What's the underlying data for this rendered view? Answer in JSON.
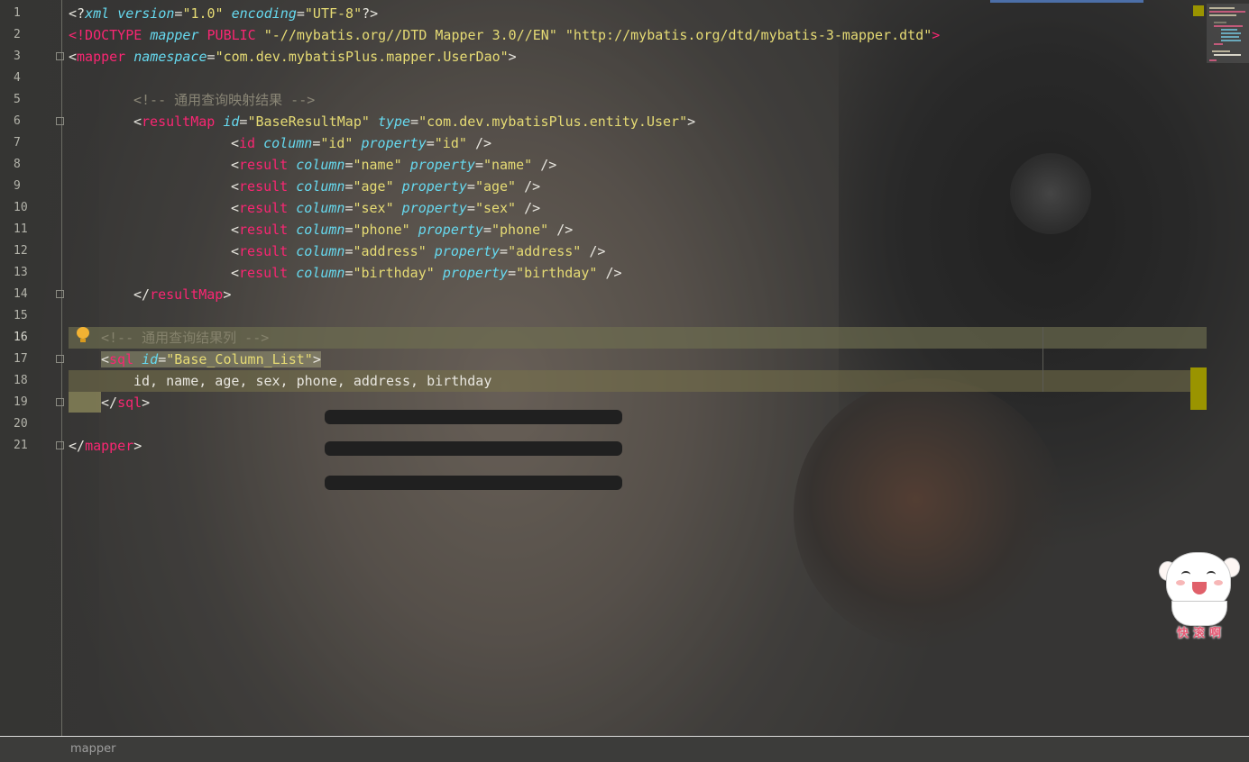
{
  "editor": {
    "line_numbers": [
      "1",
      "2",
      "3",
      "4",
      "5",
      "6",
      "7",
      "8",
      "9",
      "10",
      "11",
      "12",
      "13",
      "14",
      "15",
      "16",
      "17",
      "18",
      "19",
      "20",
      "21"
    ],
    "xml_decl": {
      "open": "<?",
      "name": "xml",
      "attr1": "version",
      "val1": "\"1.0\"",
      "attr2": "encoding",
      "val2": "\"UTF-8\"",
      "close": "?>"
    },
    "doctype": {
      "kw": "<!DOCTYPE",
      "name": "mapper",
      "kw2": "PUBLIC",
      "public_id": "\"-//mybatis.org//DTD Mapper 3.0//EN\"",
      "system_id": "\"http://mybatis.org/dtd/mybatis-3-mapper.dtd\"",
      "close": ">"
    },
    "mapper_open": {
      "tag": "mapper",
      "attr": "namespace",
      "val": "\"com.dev.mybatisPlus.mapper.UserDao\""
    },
    "comment_result": "<!-- 通用查询映射结果 -->",
    "result_map": {
      "tag": "resultMap",
      "attr1": "id",
      "val1": "\"BaseResultMap\"",
      "attr2": "type",
      "val2": "\"com.dev.mybatisPlus.entity.User\""
    },
    "id_line": {
      "tag": "id",
      "attr1": "column",
      "val1": "\"id\"",
      "attr2": "property",
      "val2": "\"id\""
    },
    "results": [
      {
        "tag": "result",
        "attr1": "column",
        "val1": "\"name\"",
        "attr2": "property",
        "val2": "\"name\""
      },
      {
        "tag": "result",
        "attr1": "column",
        "val1": "\"age\"",
        "attr2": "property",
        "val2": "\"age\""
      },
      {
        "tag": "result",
        "attr1": "column",
        "val1": "\"sex\"",
        "attr2": "property",
        "val2": "\"sex\""
      },
      {
        "tag": "result",
        "attr1": "column",
        "val1": "\"phone\"",
        "attr2": "property",
        "val2": "\"phone\""
      },
      {
        "tag": "result",
        "attr1": "column",
        "val1": "\"address\"",
        "attr2": "property",
        "val2": "\"address\""
      },
      {
        "tag": "result",
        "attr1": "column",
        "val1": "\"birthday\"",
        "attr2": "property",
        "val2": "\"birthday\""
      }
    ],
    "result_map_close": "resultMap",
    "comment_columns": "<!-- 通用查询结果列 -->",
    "sql_open": {
      "tag": "sql",
      "attr": "id",
      "val": "\"Base_Column_List\""
    },
    "sql_body": "id, name, age, sex, phone, address, birthday",
    "sql_close": "sql",
    "mapper_close": "mapper"
  },
  "sticker": {
    "text": "快滚啊"
  },
  "status_bar": {
    "breadcrumb": "mapper"
  },
  "colors": {
    "tag": "#f92672",
    "attr": "#66d9ef",
    "string": "#e6db74",
    "comment": "#8a8676",
    "marker": "#9a9400"
  }
}
